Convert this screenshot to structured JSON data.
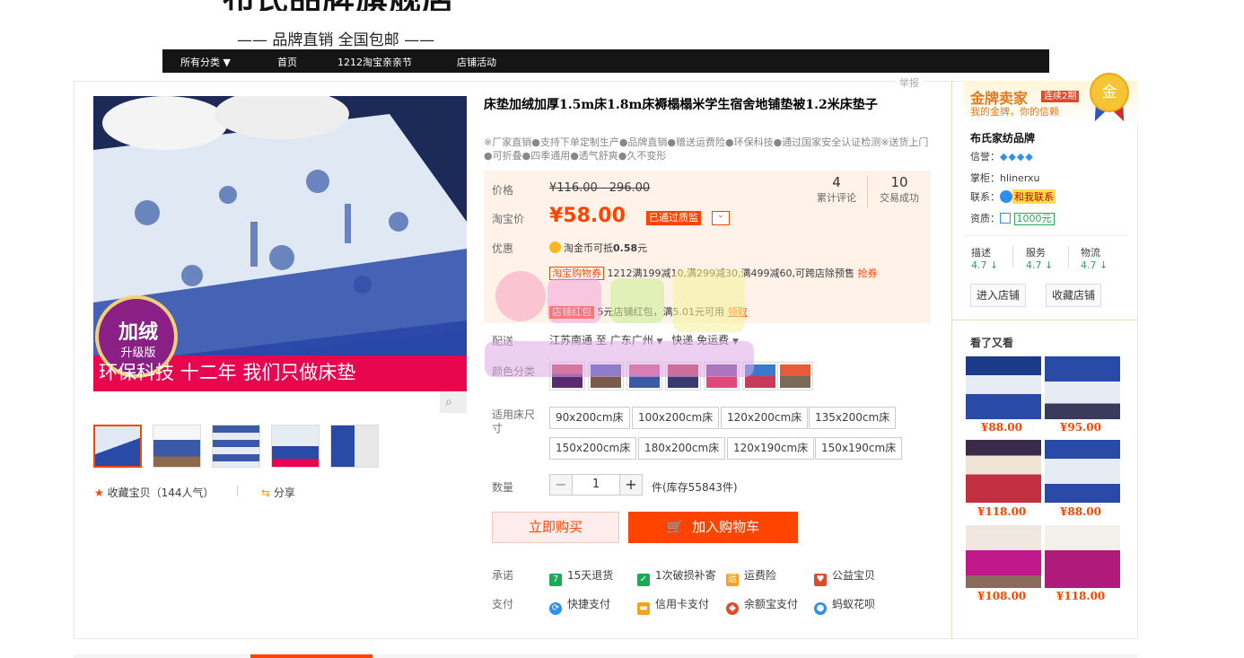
{
  "header": {
    "banner_fragment": "布氏品牌旗舰店",
    "slogan": "—— 品牌直销  全国包邮 ——"
  },
  "nav": {
    "items": [
      "所有分类 ▼",
      "首页",
      "1212淘宝亲亲节",
      "店铺活动"
    ]
  },
  "report_label": "举报",
  "product": {
    "title": "床垫加绒加厚1.5m床1.8m床褥榻榻米学生宿舍地铺垫被1.2米床垫子",
    "subtitle": "※厂家直销●支持下单定制生产●品牌直销●赠送运费险●环保科技●通过国家安全认证检测※送货上门●可折叠●四季通用●透气舒爽●久不变形",
    "image_badge_line1": "加绒",
    "image_badge_line2": "升级版",
    "image_banner": "环保科技 十二年 我们只做床垫"
  },
  "price": {
    "label_price": "价格",
    "original": "¥116.00 - 296.00",
    "label_tb_price": "淘宝价",
    "current": "¥58.00",
    "quality_badge": "已通过质监",
    "reviews_count": "4",
    "reviews_label": "累计评论",
    "deals_count": "10",
    "deals_label": "交易成功"
  },
  "promo": {
    "label": "优惠",
    "coin_text": "淘金币可抵",
    "coin_amount": "0.58",
    "coin_unit": "元",
    "coupon_tag": "淘宝购物券",
    "coupon_text": "1212满199减10,满299减30,满499减60,可跨店除预售",
    "coupon_link": "抢券",
    "redpack_tag": "店铺红包",
    "redpack_text": "5元店铺红包，满5.01元可用",
    "redpack_link": "领取"
  },
  "delivery": {
    "label": "配送",
    "from": "江苏南通",
    "to_word": "至",
    "to": "广东广州",
    "method": "快递 免运费"
  },
  "sku": {
    "color_label": "颜色分类",
    "size_label": "适用床尺寸",
    "sizes": [
      "90x200cm床",
      "100x200cm床",
      "120x200cm床",
      "135x200cm床",
      "150x200cm床",
      "180x200cm床",
      "120x190cm床",
      "150x190cm床"
    ]
  },
  "quantity": {
    "label": "数量",
    "value": "1",
    "minus": "−",
    "plus": "+",
    "stock": "件(库存55843件)"
  },
  "actions": {
    "buy_now": "立即购买",
    "add_cart": "加入购物车"
  },
  "promise": {
    "label": "承诺",
    "items": [
      "15天退货",
      "1次破损补寄",
      "运费险",
      "公益宝贝"
    ]
  },
  "payment": {
    "label": "支付",
    "items": [
      "快捷支付",
      "信用卡支付",
      "余额宝支付",
      "蚂蚁花呗"
    ]
  },
  "collect": {
    "text": "收藏宝贝（144人气）",
    "share": "分享"
  },
  "seller": {
    "gold_title": "金牌卖家",
    "gold_badge": "连续2期",
    "gold_sub": "我的金牌，你的信赖",
    "medal": "金",
    "shop_name": "布氏家纺品牌",
    "credit_label": "信誉：",
    "credit_diamonds": "◆◆◆◆",
    "keeper_label": "掌柜：",
    "keeper": "hlinerxu",
    "contact_label": "联系：",
    "contact_badge": "和我联系",
    "qual_label": "资质：",
    "deposit": "1000元",
    "scores": [
      {
        "label": "描述",
        "value": "4.7 ↓"
      },
      {
        "label": "服务",
        "value": "4.7 ↓"
      },
      {
        "label": "物流",
        "value": "4.7 ↓"
      }
    ],
    "enter_shop": "进入店铺",
    "fav_shop": "收藏店铺"
  },
  "recommend": {
    "title": "看了又看",
    "prices": [
      "¥88.00",
      "¥95.00",
      "¥118.00",
      "¥88.00",
      "¥108.00",
      "¥118.00"
    ]
  },
  "colors": {
    "accent": "#ff4400",
    "nav_bg": "#151515",
    "price_panel": "#fff2e8",
    "gold": "#e4781f"
  }
}
